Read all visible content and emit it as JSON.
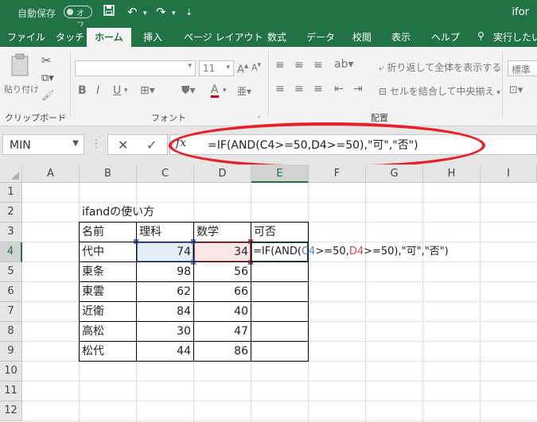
{
  "titlebar": {
    "autosave_label": "自動保存",
    "autosave_state": "オフ",
    "filename": "ifor"
  },
  "tabs": [
    "ファイル",
    "タッチ",
    "ホーム",
    "挿入",
    "ページ レイアウト",
    "数式",
    "データ",
    "校閲",
    "表示",
    "ヘルプ",
    "実行したい"
  ],
  "ribbon": {
    "paste_label": "貼り付け",
    "clipboard_group": "クリップボード",
    "font_size": "11",
    "font_group": "フォント",
    "wrap_text": "折り返して全体を表示する",
    "merge_center": "セルを結合して中央揃え",
    "alignment_group": "配置",
    "number_format": "標準"
  },
  "formula_bar": {
    "name_box": "MIN",
    "formula": "=IF(AND(C4>=50,D4>=50),\"可\",\"否\")"
  },
  "columns": [
    "A",
    "B",
    "C",
    "D",
    "E",
    "F",
    "G",
    "H",
    "I"
  ],
  "rows": [
    "1",
    "2",
    "3",
    "4",
    "5",
    "6",
    "7",
    "8",
    "9",
    "10",
    "11",
    "12"
  ],
  "sheet": {
    "title": "ifandの使い方",
    "headers": [
      "名前",
      "理科",
      "数学",
      "可否"
    ],
    "data_rows": [
      {
        "name": "代中",
        "science": "74",
        "math": "34"
      },
      {
        "name": "東条",
        "science": "98",
        "math": "56"
      },
      {
        "name": "東雲",
        "science": "62",
        "math": "66"
      },
      {
        "name": "近衛",
        "science": "84",
        "math": "40"
      },
      {
        "name": "高松",
        "science": "30",
        "math": "47"
      },
      {
        "name": "松代",
        "science": "44",
        "math": "86"
      }
    ],
    "edit_formula": {
      "p1": "=IF(AND(",
      "ref1": "C4",
      "p2": ">=50,",
      "ref2": "D4",
      "p3": ">=50),\"可\",\"否\")"
    }
  },
  "colors": {
    "excel_green": "#217346",
    "ref_blue": "#4c7fd6",
    "ref_red": "#d04a4a",
    "annotation_oval": "#e8202a"
  }
}
